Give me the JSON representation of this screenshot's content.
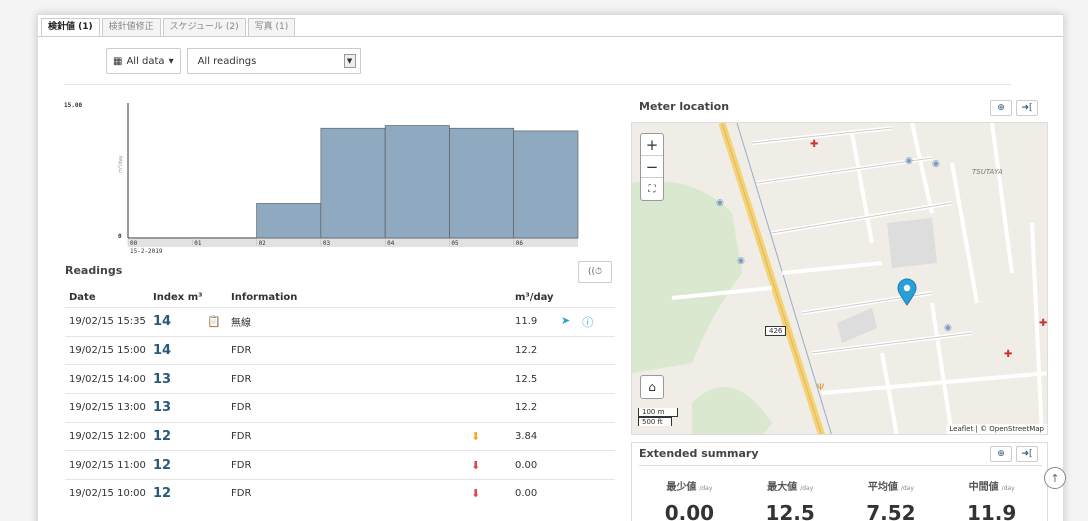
{
  "tabs": [
    {
      "label": "検針値 (1)",
      "active": true
    },
    {
      "label": "検針値修正",
      "active": false
    },
    {
      "label": "スケジュール (2)",
      "active": false
    },
    {
      "label": "写真 (1)",
      "active": false
    }
  ],
  "filter": {
    "data_button": "All data",
    "readings_select": "All readings"
  },
  "chart_data": {
    "type": "bar",
    "categories": [
      "00",
      "01",
      "02",
      "03",
      "04",
      "05",
      "06"
    ],
    "values": [
      0,
      0,
      3.84,
      12.2,
      12.5,
      12.2,
      11.9
    ],
    "ylim": [
      0,
      15
    ],
    "y_top_label": "15.00",
    "y_bottom_label": "0",
    "ylabel": "m³/day",
    "date_label": "15-2-2019",
    "color": "#8fa9c0"
  },
  "readings": {
    "title": "Readings",
    "headers": {
      "date": "Date",
      "index": "Index m³",
      "information": "Information",
      "rate": "m³/day"
    },
    "rows": [
      {
        "date": "19/02/15 15:35",
        "index": "14",
        "device": "📋",
        "info": "無線",
        "trend": "",
        "rate": "11.9",
        "nav": "➤",
        "detail": "ⓘ"
      },
      {
        "date": "19/02/15 15:00",
        "index": "14",
        "device": "",
        "info": "FDR",
        "trend": "",
        "rate": "12.2",
        "nav": "",
        "detail": ""
      },
      {
        "date": "19/02/15 14:00",
        "index": "13",
        "device": "",
        "info": "FDR",
        "trend": "",
        "rate": "12.5",
        "nav": "",
        "detail": ""
      },
      {
        "date": "19/02/15 13:00",
        "index": "13",
        "device": "",
        "info": "FDR",
        "trend": "",
        "rate": "12.2",
        "nav": "",
        "detail": ""
      },
      {
        "date": "19/02/15 12:00",
        "index": "12",
        "device": "",
        "info": "FDR",
        "trend": "⬇",
        "trend_color": "#f5a623",
        "rate": "3.84",
        "nav": "",
        "detail": ""
      },
      {
        "date": "19/02/15 11:00",
        "index": "12",
        "device": "",
        "info": "FDR",
        "trend": "⬇",
        "trend_color": "#e0424f",
        "rate": "0.00",
        "nav": "",
        "detail": ""
      },
      {
        "date": "19/02/15 10:00",
        "index": "12",
        "device": "",
        "info": "FDR",
        "trend": "⬇",
        "trend_color": "#e0424f",
        "rate": "0.00",
        "nav": "",
        "detail": ""
      }
    ]
  },
  "map": {
    "title": "Meter location",
    "road_number": "426",
    "place_label": "TSUTAYA",
    "scale_m": "100 m",
    "scale_ft": "500 ft",
    "attribution": "Leaflet | © OpenStreetMap",
    "marker_color": "#2a9fd6"
  },
  "summary": {
    "title": "Extended summary",
    "unit": "/day",
    "stats": [
      {
        "label": "最少値",
        "value": "0.00"
      },
      {
        "label": "最大値",
        "value": "12.5"
      },
      {
        "label": "平均値",
        "value": "7.52"
      },
      {
        "label": "中間値",
        "value": "11.9"
      }
    ]
  }
}
